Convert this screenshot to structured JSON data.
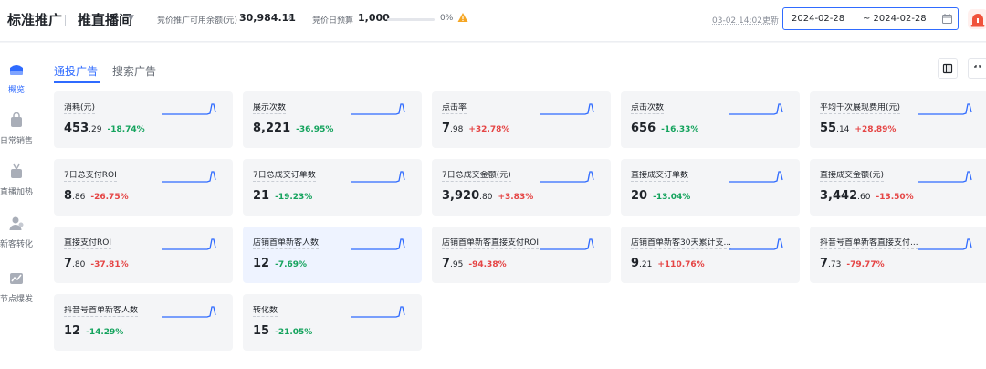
{
  "header": {
    "brand": "标准推广",
    "mode": "推直播间",
    "balance_label": "竞价推广可用余额(元)",
    "balance_value": "30,984.11",
    "budget_label": "竞价日预算",
    "budget_value": "1,000",
    "budget_progress": 0,
    "budget_percent": "0%",
    "update_time": "03-02 14:02更新",
    "date_start": "2024-02-28",
    "date_end": "~ 2024-02-28"
  },
  "sidebar": {
    "items": [
      {
        "label": "概览",
        "icon": "overview-icon",
        "active": true
      },
      {
        "label": "日常销售",
        "icon": "shopping-bag-icon",
        "active": false
      },
      {
        "label": "直播加热",
        "icon": "tv-icon",
        "active": false
      },
      {
        "label": "新客转化",
        "icon": "users-icon",
        "active": false
      },
      {
        "label": "节点爆发",
        "icon": "trend-chart-icon",
        "active": false
      }
    ]
  },
  "tabs": [
    {
      "label": "通投广告",
      "active": true
    },
    {
      "label": "搜索广告",
      "active": false
    }
  ],
  "colors": {
    "accent": "#2f6bff",
    "up": "#e54545",
    "down": "#14a35d",
    "warning": "#f5a623"
  },
  "metrics": [
    {
      "title": "消耗(元)",
      "int": "453",
      "dec": ".29",
      "change": "-18.74%",
      "dir": "down"
    },
    {
      "title": "展示次数",
      "int": "8,221",
      "dec": "",
      "change": "-36.95%",
      "dir": "down"
    },
    {
      "title": "点击率",
      "int": "7",
      "dec": ".98",
      "change": "+32.78%",
      "dir": "up"
    },
    {
      "title": "点击次数",
      "int": "656",
      "dec": "",
      "change": "-16.33%",
      "dir": "down"
    },
    {
      "title": "平均千次展现费用(元)",
      "int": "55",
      "dec": ".14",
      "change": "+28.89%",
      "dir": "up"
    },
    {
      "title": "7日总支付ROI",
      "int": "8",
      "dec": ".86",
      "change": "-26.75%",
      "dir": "up"
    },
    {
      "title": "7日总成交订单数",
      "int": "21",
      "dec": "",
      "change": "-19.23%",
      "dir": "down"
    },
    {
      "title": "7日总成交金额(元)",
      "int": "3,920",
      "dec": ".80",
      "change": "+3.83%",
      "dir": "up"
    },
    {
      "title": "直接成交订单数",
      "int": "20",
      "dec": "",
      "change": "-13.04%",
      "dir": "down"
    },
    {
      "title": "直接成交金额(元)",
      "int": "3,442",
      "dec": ".60",
      "change": "-13.50%",
      "dir": "up"
    },
    {
      "title": "直接支付ROI",
      "int": "7",
      "dec": ".80",
      "change": "-37.81%",
      "dir": "up"
    },
    {
      "title": "店铺首单新客人数",
      "int": "12",
      "dec": "",
      "change": "-7.69%",
      "dir": "down",
      "highlight": true
    },
    {
      "title": "店铺首单新客直接支付ROI",
      "int": "7",
      "dec": ".95",
      "change": "-94.38%",
      "dir": "up"
    },
    {
      "title": "店铺首单新客30天累计支...",
      "int": "9",
      "dec": ".21",
      "change": "+110.76%",
      "dir": "up"
    },
    {
      "title": "抖音号首单新客直接支付...",
      "int": "7",
      "dec": ".73",
      "change": "-79.77%",
      "dir": "up"
    },
    {
      "title": "抖音号首单新客人数",
      "int": "12",
      "dec": "",
      "change": "-14.29%",
      "dir": "down"
    },
    {
      "title": "转化数",
      "int": "15",
      "dec": "",
      "change": "-21.05%",
      "dir": "down"
    }
  ]
}
